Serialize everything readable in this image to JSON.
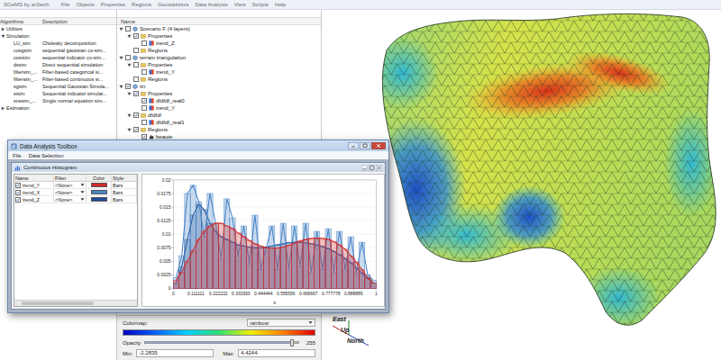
{
  "window": {
    "title": "SGeMS by ar2tech"
  },
  "menu": [
    "File",
    "Objects",
    "Properties",
    "Regions",
    "Geostatistics",
    "Data Analysis",
    "View",
    "Scripts",
    "Help"
  ],
  "algorithms": {
    "columns": [
      "Algorithms",
      "Description"
    ],
    "items": [
      {
        "name": "Utilities",
        "description": "",
        "expanded": false,
        "has_children": true
      },
      {
        "name": "Simulation",
        "description": "",
        "expanded": true,
        "has_children": true,
        "children": [
          {
            "name": "LU_sim",
            "description": "Cholesky decomposition",
            "expanded": false,
            "has_children": false
          },
          {
            "name": "cosgsim",
            "description": "sequential gaussian co-sim...",
            "expanded": false,
            "has_children": false
          },
          {
            "name": "cosisim",
            "description": "sequential indicator co-sim...",
            "expanded": false,
            "has_children": false
          },
          {
            "name": "dssim",
            "description": "Direct sequential simulation",
            "expanded": false,
            "has_children": false
          },
          {
            "name": "filtersim_...",
            "description": "Filter-based categorical si...",
            "expanded": false,
            "has_children": false
          },
          {
            "name": "filtersim_...",
            "description": "Filter-based continuous si...",
            "expanded": false,
            "has_children": false
          },
          {
            "name": "sgsim",
            "description": "Sequential Gaussian Simula...",
            "expanded": false,
            "has_children": false
          },
          {
            "name": "sisim",
            "description": "Sequential indicator simulat...",
            "expanded": false,
            "has_children": false
          },
          {
            "name": "snesim_...",
            "description": "Single normal equation sim...",
            "expanded": false,
            "has_children": false
          }
        ]
      },
      {
        "name": "Estimation",
        "description": "",
        "expanded": false,
        "has_children": true
      }
    ]
  },
  "objects": {
    "column": "Name",
    "items": [
      {
        "name": "Scenario F (4 layers)",
        "kind": "object",
        "checked": false,
        "expanded": true,
        "has_children": true,
        "children": [
          {
            "name": "Properties",
            "kind": "folder",
            "checked": true,
            "expanded": true,
            "has_children": true,
            "children": [
              {
                "name": "trend_Z",
                "kind": "property",
                "checked": false,
                "expanded": false,
                "has_children": false
              }
            ]
          },
          {
            "name": "Regions",
            "kind": "folder",
            "checked": false,
            "expanded": false,
            "has_children": false
          }
        ]
      },
      {
        "name": "terrain triangulation",
        "kind": "object",
        "checked": false,
        "expanded": true,
        "has_children": true,
        "children": [
          {
            "name": "Properties",
            "kind": "folder",
            "checked": false,
            "expanded": true,
            "has_children": true,
            "children": [
              {
                "name": "trend_Y",
                "kind": "property",
                "checked": false,
                "expanded": false,
                "has_children": false
              }
            ]
          },
          {
            "name": "Regions",
            "kind": "folder",
            "checked": false,
            "expanded": false,
            "has_children": false
          }
        ]
      },
      {
        "name": "tin",
        "kind": "object",
        "checked": true,
        "expanded": true,
        "has_children": true,
        "children": [
          {
            "name": "Properties",
            "kind": "folder",
            "checked": true,
            "expanded": true,
            "has_children": true,
            "children": [
              {
                "name": "dfdfdf_real0",
                "kind": "property",
                "checked": true,
                "expanded": false,
                "has_children": false
              },
              {
                "name": "trend_Y",
                "kind": "property",
                "checked": false,
                "expanded": false,
                "has_children": false
              }
            ]
          },
          {
            "name": "dfdfdf",
            "kind": "folder",
            "checked": true,
            "expanded": true,
            "has_children": true,
            "children": [
              {
                "name": "dfdfdf_real1",
                "kind": "property",
                "checked": false,
                "expanded": false,
                "has_children": false
              }
            ]
          },
          {
            "name": "Regions",
            "kind": "folder",
            "checked": true,
            "expanded": true,
            "has_children": true,
            "children": [
              {
                "name": "beaute",
                "kind": "region",
                "checked": true,
                "expanded": false,
                "has_children": false
              }
            ]
          }
        ]
      }
    ]
  },
  "colormap": {
    "label": "Colormap:",
    "value": "rainbow",
    "opacity_label": "Opacity",
    "opacity": {
      "level": 0.96,
      "reading": "255"
    },
    "min_label": "Min:",
    "min": "-2.2835",
    "max_label": "Max:",
    "max": "4.4244"
  },
  "view": {
    "axes": {
      "east": "East",
      "up": "Up",
      "north": "North"
    }
  },
  "toolbox": {
    "title": "Data Analysis Toolbox",
    "menu": [
      "File",
      "Data Selection"
    ],
    "subwindow": {
      "title": "Continuous Histogram",
      "columns": [
        "Name",
        "Filter",
        "Color",
        "Style"
      ],
      "rows": [
        {
          "name": "trend_Y",
          "checked": true,
          "filter": "<None>",
          "color": "#d42a2a",
          "style": "Bars",
          "values": [
            0.0015,
            0.003,
            0.005,
            0.007,
            0.009,
            0.0105,
            0.0115,
            0.012,
            0.012,
            0.0115,
            0.011,
            0.0102,
            0.0095,
            0.0088,
            0.0082,
            0.0078,
            0.0075,
            0.0074,
            0.0074,
            0.0076,
            0.0079,
            0.0083,
            0.0087,
            0.009,
            0.0092,
            0.0093,
            0.0092,
            0.009,
            0.0086,
            0.008,
            0.0072,
            0.006,
            0.0048,
            0.0034,
            0.002,
            0.001
          ]
        },
        {
          "name": "trend_X",
          "checked": true,
          "filter": "<None>",
          "color": "#4a86c8",
          "style": "Bars",
          "values": [
            0.002,
            0.006,
            0.0175,
            0.019,
            0.016,
            0.0095,
            0.0175,
            0.012,
            0.0055,
            0.0165,
            0.013,
            0.006,
            0.0115,
            0.0045,
            0.0135,
            0.0035,
            0.0075,
            0.0115,
            0.0035,
            0.012,
            0.0035,
            0.0115,
            0.004,
            0.012,
            0.003,
            0.0105,
            0.0035,
            0.011,
            0.003,
            0.0105,
            0.0035,
            0.0095,
            0.003,
            0.0085,
            0.0025,
            0.0015
          ]
        },
        {
          "name": "trend_Z",
          "checked": true,
          "filter": "<None>",
          "color": "#1f4f99",
          "style": "Bars",
          "values": [
            0.001,
            0.004,
            0.009,
            0.0135,
            0.0155,
            0.0145,
            0.012,
            0.0105,
            0.0095,
            0.009,
            0.0085,
            0.008,
            0.0078,
            0.0076,
            0.0075,
            0.0075,
            0.0076,
            0.0078,
            0.008,
            0.0082,
            0.0084,
            0.0085,
            0.0085,
            0.0084,
            0.0082,
            0.008,
            0.0077,
            0.0073,
            0.0068,
            0.0062,
            0.0055,
            0.0047,
            0.0038,
            0.0028,
            0.0018,
            0.001
          ]
        }
      ]
    },
    "chart": {
      "y_ticks": [
        "0.02",
        "0.0175",
        "0.015",
        "0.0125",
        "0.01",
        "0.0075",
        "0.005",
        "0.0025",
        "0"
      ],
      "x_ticks": [
        "0",
        "0.111111",
        "0.222222",
        "0.333333",
        "0.444444",
        "0.555556",
        "0.666667",
        "0.777778",
        "0.888889",
        "1"
      ],
      "x_label": "x"
    }
  }
}
